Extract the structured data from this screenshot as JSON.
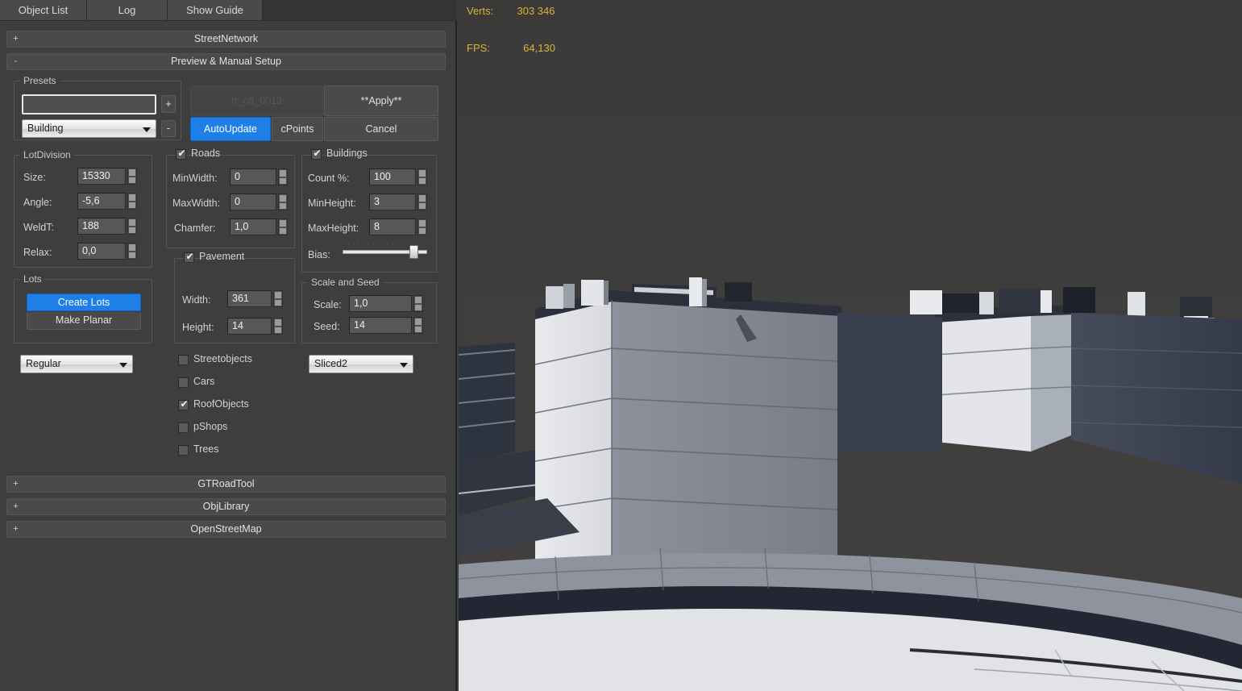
{
  "tabs": [
    {
      "label": "Object List",
      "name": "tab-object-list"
    },
    {
      "label": "Log",
      "name": "tab-log"
    },
    {
      "label": "Show Guide",
      "name": "tab-show-guide"
    }
  ],
  "rollouts": {
    "street_network": {
      "title": "StreetNetwork",
      "knob": "+"
    },
    "preview_manual": {
      "title": "Preview & Manual Setup",
      "knob": "-"
    },
    "gt_road_tool": {
      "title": "GTRoadTool",
      "knob": "+"
    },
    "obj_library": {
      "title": "ObjLibrary",
      "knob": "+"
    },
    "open_street_map": {
      "title": "OpenStreetMap",
      "knob": "+"
    }
  },
  "presets": {
    "caption": "Presets",
    "name_value": "",
    "name_placeholder": "",
    "add_label": "+",
    "remove_label": "-",
    "selected": "Building",
    "options": [
      "Building"
    ]
  },
  "actions": {
    "status_label": "rt_off_0013",
    "apply_label": "**Apply**",
    "autoupdate_label": "AutoUpdate",
    "dpoints_label": "cPoints",
    "cancel_label": "Cancel"
  },
  "lot_division": {
    "caption": "LotDivision",
    "fields": [
      {
        "label": "Size:",
        "value": "15330",
        "name": "size"
      },
      {
        "label": "Angle:",
        "value": "-5,6",
        "name": "angle"
      },
      {
        "label": "WeldT:",
        "value": "188",
        "name": "weldt"
      },
      {
        "label": "Relax:",
        "value": "0,0",
        "name": "relax"
      }
    ]
  },
  "lots": {
    "caption": "Lots",
    "create_label": "Create Lots",
    "make_planar_label": "Make Planar"
  },
  "lot_type": {
    "selected": "Regular",
    "options": [
      "Regular"
    ]
  },
  "roads": {
    "caption": "Roads",
    "checked": true,
    "fields": [
      {
        "label": "MinWidth:",
        "value": "0",
        "name": "minwidth"
      },
      {
        "label": "MaxWidth:",
        "value": "0",
        "name": "maxwidth"
      },
      {
        "label": "Chamfer:",
        "value": "1,0",
        "name": "chamfer"
      }
    ]
  },
  "pavement": {
    "caption": "Pavement",
    "checked": true,
    "fields": [
      {
        "label": "Width:",
        "value": "361",
        "name": "width"
      },
      {
        "label": "Height:",
        "value": "14",
        "name": "height"
      }
    ]
  },
  "buildings": {
    "caption": "Buildings",
    "checked": true,
    "fields": [
      {
        "label": "Count %:",
        "value": "100",
        "name": "count-pct"
      },
      {
        "label": "MinHeight:",
        "value": "3",
        "name": "minheight"
      },
      {
        "label": "MaxHeight:",
        "value": "8",
        "name": "maxheight"
      }
    ],
    "bias_label": "Bias:",
    "bias_percent": 88
  },
  "scale_seed": {
    "caption": "Scale and Seed",
    "fields": [
      {
        "label": "Scale:",
        "value": "1,0",
        "name": "scale"
      },
      {
        "label": "Seed:",
        "value": "14",
        "name": "seed"
      }
    ]
  },
  "options": [
    {
      "label": "Streetobjects",
      "checked": false,
      "name": "streetobjects"
    },
    {
      "label": "Cars",
      "checked": false,
      "name": "cars"
    },
    {
      "label": "RoofObjects",
      "checked": true,
      "name": "roofobjects"
    },
    {
      "label": "pShops",
      "checked": false,
      "name": "pshops"
    },
    {
      "label": "Trees",
      "checked": false,
      "name": "trees"
    }
  ],
  "building_style": {
    "selected": "Sliced2",
    "options": [
      "Sliced2"
    ]
  },
  "viewport": {
    "stats": [
      {
        "label": "Verts:",
        "value": "303 346",
        "name": "verts"
      },
      {
        "label": "FPS:",
        "value": "64,130",
        "name": "fps"
      }
    ]
  },
  "colors": {
    "accent": "#1e7fe8",
    "panel_bg": "#3e3e3e",
    "stat_text": "#d9b43c",
    "viewport_bg": "#3c3b3a"
  }
}
